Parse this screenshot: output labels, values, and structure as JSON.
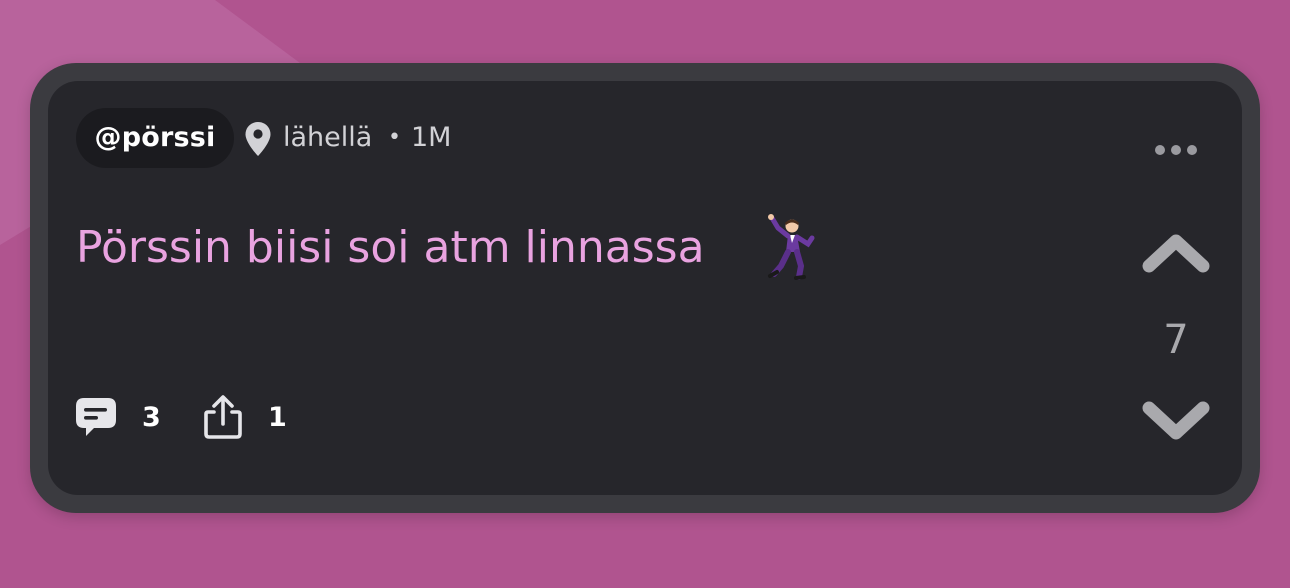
{
  "colors": {
    "background": "#b0548f",
    "card_frame": "#3b3b40",
    "card": "#26262b",
    "handle_pill": "#1b1b1f",
    "post_text": "#e9a3e0",
    "meta_text": "#d2d2d6",
    "vote_arrows": "#a9a9ad"
  },
  "post": {
    "handle": "@pörssi",
    "location_icon": "map-pin-icon",
    "location": "lähellä",
    "separator": "•",
    "time": "1M",
    "more_icon": "more-horizontal-icon",
    "text": "Pörssin biisi soi atm linnassa",
    "emoji_icon": "man-dancing-icon",
    "votes": {
      "upvote_icon": "chevron-up-icon",
      "score": "7",
      "downvote_icon": "chevron-down-icon"
    },
    "actions": {
      "comment_icon": "comment-bubble-icon",
      "comment_count": "3",
      "share_icon": "share-icon",
      "share_count": "1"
    }
  }
}
